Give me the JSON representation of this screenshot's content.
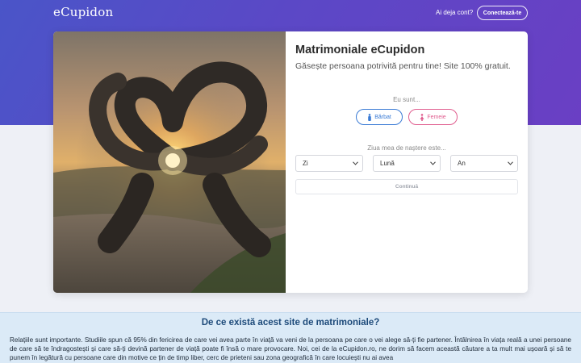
{
  "header": {
    "logo": "eCupidon",
    "already_account": "Ai deja cont?",
    "login_button": "Conectează-te"
  },
  "form": {
    "title": "Matrimoniale eCupidon",
    "subtitle": "Găsește persoana potrivită pentru tine! Site 100% gratuit.",
    "i_am_label": "Eu sunt...",
    "gender_options": [
      {
        "label": "Bărbat",
        "icon": "male-icon",
        "color": "#3a7bd5"
      },
      {
        "label": "Femeie",
        "icon": "female-icon",
        "color": "#e05e8f"
      }
    ],
    "birthdate_label": "Ziua mea de naștere este...",
    "day_select": "Zi",
    "month_select": "Lună",
    "year_select": "An",
    "continue_button": "Continuă"
  },
  "info": {
    "title": "De ce există acest site de matrimoniale?",
    "text": "Relațiile sunt importante. Studiile spun că 95% din fericirea de care vei avea parte în viață va veni de la persoana pe care o vei alege să-ți fie partener. Întâlnirea în viața reală a unei persoane de care să te îndragostești și care să-ți devină partener de viață poate fi însă o mare provocare. Noi, cei de la eCupidon.ro, ne dorim să facem această căutare a ta mult mai ușoară și să te punem în legătură cu persoane care din motive ce țin de timp liber, cerc de prieteni sau zona geografică în care locuiești nu ai avea"
  },
  "colors": {
    "hero_gradient_start": "#4a55c8",
    "hero_gradient_end": "#6a3fc4",
    "male_accent": "#3a7bd5",
    "female_accent": "#e05e8f",
    "info_bg": "#dbeaf7",
    "info_title": "#1d4a7a"
  }
}
